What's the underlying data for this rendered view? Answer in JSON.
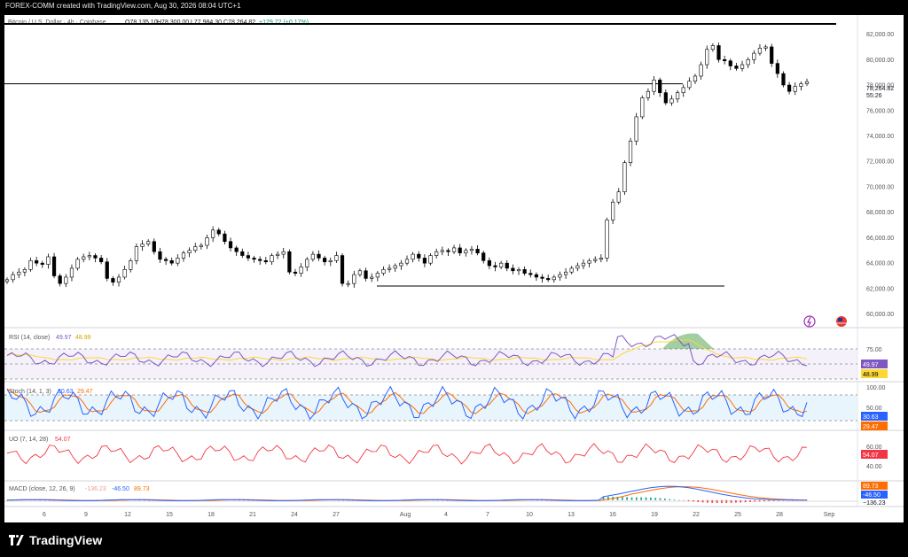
{
  "header": {
    "publisher_line": "FOREX-COMM created with TradingView.com, Aug 30, 2026 08:04 UTC+1"
  },
  "symbol_line": {
    "name": "Bitcoin / U.S. Dollar · 4h · Coinbase",
    "open": "O78,135.10",
    "high": "H78,300.00",
    "low": "L77,984.30",
    "close": "C78,264.82",
    "change": "+129.72 (+0.17%)"
  },
  "price_axis": {
    "ticks": [
      "82,000.00",
      "80,000.00",
      "78,000.00",
      "76,000.00",
      "74,000.00",
      "72,000.00",
      "70,000.00",
      "68,000.00",
      "66,000.00",
      "64,000.00",
      "62,000.00",
      "60,000.00"
    ],
    "last_price": "78,264.82",
    "countdown": "55:26"
  },
  "date_axis": {
    "ticks": [
      "6",
      "9",
      "12",
      "15",
      "18",
      "21",
      "24",
      "27",
      "Aug",
      "4",
      "7",
      "10",
      "13",
      "16",
      "19",
      "22",
      "25",
      "28",
      "Sep"
    ]
  },
  "rsi": {
    "title": "RSI (14, close)",
    "v1": "49.97",
    "v2": "48.99",
    "ticks": [
      "75.00"
    ],
    "label1": "49.97",
    "label2": "48.99"
  },
  "stoch": {
    "title": "Stoch (14, 1, 3)",
    "v1": "30.63",
    "v2": "29.47",
    "ticks": [
      "100.00",
      "50.00"
    ],
    "label1": "30.63",
    "label2": "29.47"
  },
  "uo": {
    "title": "UO (7, 14, 28)",
    "v1": "54.07",
    "ticks": [
      "60.00",
      "40.00"
    ],
    "label1": "54.07"
  },
  "macd": {
    "title": "MACD (close, 12, 26, 9)",
    "v_hist": "-136.23",
    "v_macd": "-46.50",
    "v_signal": "89.73",
    "label_signal": "89.73",
    "label_macd": "-46.50",
    "label_hist": "−136.23"
  },
  "footer": {
    "brand": "TradingView"
  },
  "colors": {
    "candle": "#000000",
    "rsi_line": "#7e57c2",
    "rsi_ma": "#fdd835",
    "stoch_k": "#2962ff",
    "stoch_d": "#ff6d00",
    "uo_line": "#f23645",
    "macd_line": "#2962ff",
    "signal_line": "#ff6d00",
    "hist_up": "#26a69a",
    "hist_down": "#ef5350"
  },
  "chart_data": {
    "type": "candlestick",
    "timeframe": "4h",
    "price_range": [
      59000,
      83500
    ],
    "key_levels": [
      {
        "name": "resistance",
        "price": 78100
      },
      {
        "name": "support",
        "price": 62200
      },
      {
        "name": "top",
        "price": 82800
      }
    ],
    "approx_closes": [
      62700,
      63100,
      63300,
      63500,
      64200,
      64000,
      63900,
      64500,
      63000,
      62400,
      62900,
      63600,
      64300,
      64500,
      64600,
      64400,
      64100,
      62800,
      62500,
      62900,
      63500,
      64200,
      65300,
      65500,
      65700,
      64900,
      64300,
      64200,
      64000,
      64400,
      64800,
      65000,
      65300,
      65400,
      66000,
      66600,
      66300,
      65700,
      65200,
      64900,
      64600,
      64400,
      64300,
      64200,
      64100,
      64600,
      64700,
      64900,
      63300,
      63200,
      63700,
      64300,
      64700,
      64400,
      64100,
      64200,
      64600,
      62400,
      62400,
      63100,
      63400,
      62800,
      62900,
      63200,
      63500,
      63600,
      63800,
      64000,
      64300,
      64700,
      64400,
      64000,
      64600,
      64900,
      65000,
      64900,
      65200,
      64800,
      65000,
      65100,
      64800,
      64200,
      63800,
      63700,
      64000,
      63600,
      63400,
      63500,
      63200,
      63100,
      62900,
      62800,
      62700,
      62900,
      63100,
      63300,
      63600,
      63800,
      64000,
      64200,
      64300,
      64400,
      67400,
      68800,
      69600,
      71900,
      73600,
      75500,
      77000,
      77500,
      78400,
      77400,
      76600,
      76900,
      77400,
      77800,
      78300,
      78700,
      79600,
      80800,
      81100,
      80000,
      79900,
      79500,
      79300,
      79600,
      80000,
      80500,
      80900,
      81000,
      79700,
      78900,
      78000,
      77500,
      77900,
      78100,
      78265
    ],
    "indicators": {
      "RSI": {
        "params": "14, close",
        "value": 49.97,
        "ma": 48.99,
        "levels": [
          70,
          30
        ],
        "tick": 75
      },
      "Stoch": {
        "params": "14, 1, 3",
        "k": 30.63,
        "d": 29.47,
        "levels": [
          80,
          20
        ],
        "ticks": [
          100,
          50
        ]
      },
      "UO": {
        "params": "7, 14, 28",
        "value": 54.07,
        "ticks": [
          60,
          40
        ]
      },
      "MACD": {
        "params": "close, 12, 26, 9",
        "hist": -136.23,
        "macd": -46.5,
        "signal": 89.73
      }
    }
  }
}
